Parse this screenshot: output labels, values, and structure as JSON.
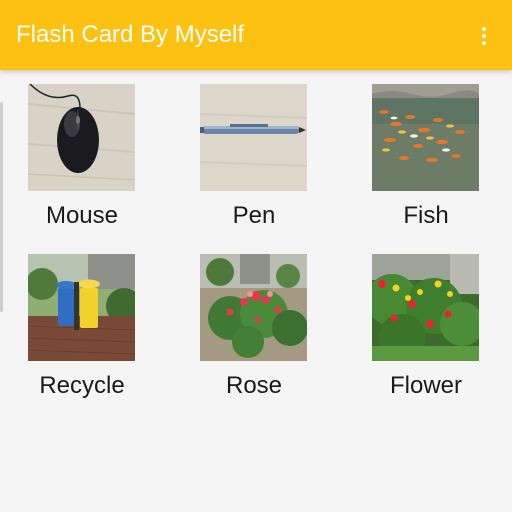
{
  "app_bar": {
    "title": "Flash Card By Myself",
    "menu_icon": "more-vert-icon"
  },
  "cards": [
    {
      "label": "Mouse",
      "image": "computer-mouse-photo"
    },
    {
      "label": "Pen",
      "image": "pen-photo"
    },
    {
      "label": "Fish",
      "image": "koi-fish-pond-photo"
    },
    {
      "label": "Recycle",
      "image": "recycle-bins-photo"
    },
    {
      "label": "Rose",
      "image": "rose-bush-photo"
    },
    {
      "label": "Flower",
      "image": "flower-bed-photo"
    }
  ]
}
